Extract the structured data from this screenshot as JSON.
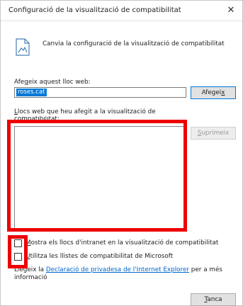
{
  "dialog": {
    "title": "Configuració de la visualització de compatibilitat",
    "close_glyph": "✕",
    "header_text": "Canvia la configuració de la visualització de compatibilitat",
    "header_icon": "document-compatibility-icon"
  },
  "add_section": {
    "label_pre": "Afe",
    "label_accel": "g",
    "label_post": "eix aquest lloc web:",
    "input_value": "roses.cat",
    "add_button_pre": "Afegei",
    "add_button_accel": "x",
    "add_button_post": ""
  },
  "list_section": {
    "label_accel": "L",
    "label_post": "locs web que heu afegit a la visualització de",
    "label_line2": "compatibilitat:",
    "items": [],
    "remove_button_accel": "S",
    "remove_button_post": "uprimeix"
  },
  "options": {
    "intranet": {
      "accel": "M",
      "label": "ostra els llocs d'intranet en la visualització de compatibilitat",
      "checked": false
    },
    "microsoft_lists": {
      "accel": "U",
      "label": "tilitza les llistes de compatibilitat de Microsoft",
      "checked": false
    }
  },
  "info": {
    "pre": "Llegeix la ",
    "link": "Declaració de privadesa de l'Internet Explorer",
    "post": " per a més informació"
  },
  "footer": {
    "close_accel": "T",
    "close_post": "anca"
  },
  "colors": {
    "highlight_box": "#ee0000",
    "selection": "#0078d7",
    "link": "#0066cc"
  }
}
